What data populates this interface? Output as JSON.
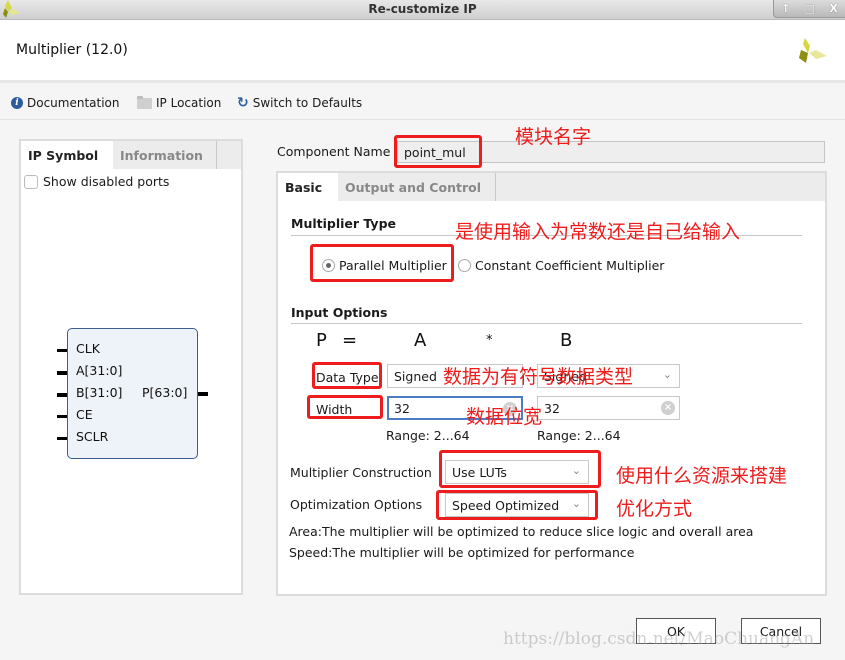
{
  "window": {
    "title": "Re-customize IP",
    "controls": [
      "↑",
      "□",
      "X"
    ]
  },
  "header": {
    "ip_title": "Multiplier (12.0)"
  },
  "toolbar": {
    "documentation": "Documentation",
    "ip_location": "IP Location",
    "switch_defaults": "Switch to Defaults"
  },
  "left_panel": {
    "tabs": [
      {
        "label": "IP Symbol",
        "active": true
      },
      {
        "label": "Information",
        "active": false
      }
    ],
    "show_disabled_ports": "Show disabled ports",
    "show_disabled_checked": false,
    "symbol": {
      "inputs": [
        "CLK",
        "A[31:0]",
        "B[31:0]",
        "CE",
        "SCLR"
      ],
      "outputs": [
        "P[63:0]"
      ]
    }
  },
  "component": {
    "label": "Component Name",
    "value": "point_mul"
  },
  "right_panel": {
    "tabs": [
      {
        "label": "Basic",
        "active": true
      },
      {
        "label": "Output and Control",
        "active": false
      }
    ],
    "multiplier_type": {
      "title": "Multiplier Type",
      "options": [
        {
          "label": "Parallel Multiplier",
          "selected": true
        },
        {
          "label": "Constant Coefficient Multiplier",
          "selected": false
        }
      ]
    },
    "input_options": {
      "title": "Input Options",
      "equation": {
        "p": "P",
        "eq": "=",
        "a": "A",
        "op": "*",
        "b": "B"
      },
      "data_type_label": "Data Type",
      "data_type_a": "Signed",
      "data_type_b": "Signed",
      "width_label": "Width",
      "width_a": "32",
      "width_b": "32",
      "range_a": "Range: 2...64",
      "range_b": "Range: 2...64"
    },
    "construction": {
      "label": "Multiplier Construction",
      "value": "Use LUTs"
    },
    "optimization": {
      "label": "Optimization Options",
      "value": "Speed Optimized"
    },
    "desc_area": "Area:The multiplier will be optimized to reduce slice logic and overall area",
    "desc_speed": "Speed:The multiplier will be optimized for performance"
  },
  "buttons": {
    "ok": "OK",
    "cancel": "Cancel"
  },
  "annotations": {
    "module_name": "模块名字",
    "input_type": "是使用输入为常数还是自己给输入",
    "signed": "数据为有符号数据类型",
    "width": "数据位宽",
    "resource": "使用什么资源来搭建",
    "optimize": "优化方式"
  },
  "watermark": "https://blog.csdn.net/MaoChuangAn"
}
